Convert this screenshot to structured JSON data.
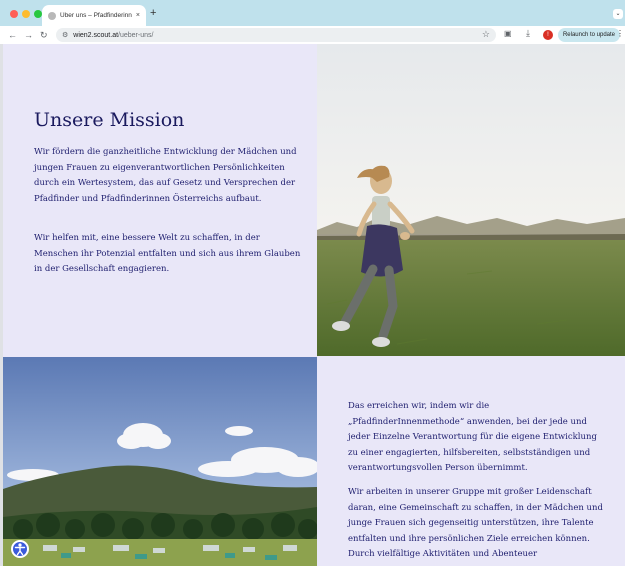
{
  "browser": {
    "tab_title": "Über uns – Pfadfinderinnen Wien",
    "tab_close": "×",
    "new_tab": "+",
    "url_host": "wien2.scout.at",
    "url_path": "/ueber-uns/",
    "profile_badge": "!",
    "relaunch_label": "Relaunch to update",
    "icons": [
      "back-icon",
      "forward-icon",
      "reload-icon",
      "tune-icon",
      "star-icon",
      "extensions-icon",
      "download-icon",
      "menu-icon"
    ]
  },
  "mission": {
    "heading": "Unsere Mission",
    "paragraph_1": "Wir fördern die ganzheitliche Entwicklung der Mädchen und jungen Frauen zu eigenverantwortlichen Persönlichkeiten durch ein Wertesystem, das auf Gesetz und Versprechen der Pfadfinder und Pfadfinderinnen Österreichs aufbaut.",
    "paragraph_2": "Wir helfen mit, eine bessere Welt zu schaffen, in der Menschen ihr Potenzial entfalten und sich aus ihrem Glauben in der Gesellschaft engagieren."
  },
  "method": {
    "paragraph_1": "Das erreichen wir, indem wir die „PfadfinderInnenmethode“ anwenden, bei der jede und jeder Einzelne Verantwortung für die eigene Entwicklung zu einer engagierten, hilfsbereiten, selbstständigen und verantwortungsvollen Person übernimmt.",
    "paragraph_2": "Wir arbeiten in unserer Gruppe mit großer Leidenschaft daran, eine Gemeinschaft zu schaffen, in der Mädchen und junge Frauen sich gegenseitig unterstützen, ihre Talente entfalten und ihre persönlichen Ziele erreichen können. Durch vielfältige Aktivitäten und Abenteuer"
  },
  "colors": {
    "page_background": "#e9e7f8",
    "text": "#1e1e6e",
    "heading": "#1a1a5e",
    "accessibility_button": "#3b5bdb"
  }
}
